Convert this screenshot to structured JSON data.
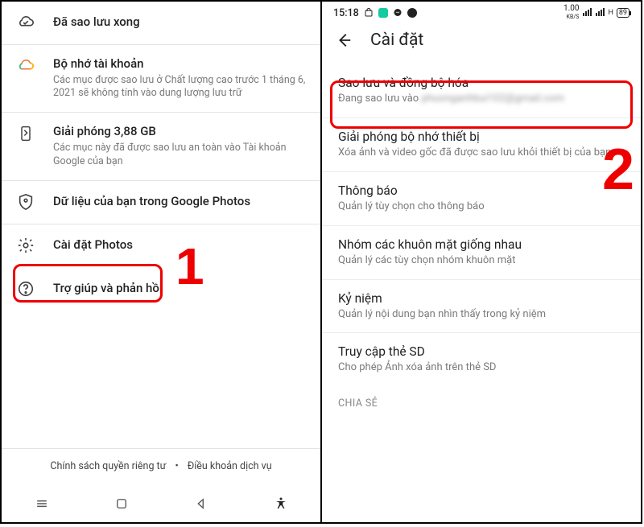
{
  "left": {
    "backup_done": "Đã sao lưu xong",
    "storage": {
      "title": "Bộ nhớ tài khoản",
      "sub": "Các mục được sao lưu ở Chất lượng cao trước 1 tháng 6, 2021 sẽ không tính vào dung lượng lưu trữ"
    },
    "free_up": {
      "title": "Giải phóng 3,88 GB",
      "sub": "Các mục này đã được sao lưu an toàn vào Tài khoản Google của bạn"
    },
    "your_data": "Dữ liệu của bạn trong Google Photos",
    "settings": "Cài đặt Photos",
    "help": "Trợ giúp và phản hồi",
    "privacy": "Chính sách quyền riêng tư",
    "terms": "Điều khoản dịch vụ"
  },
  "right": {
    "status_time": "15:18",
    "status_speed": "1.00",
    "status_speed_unit": "KB/S",
    "status_battery": "89",
    "header": "Cài đặt",
    "backup": {
      "title": "Sao lưu và đồng bộ hóa",
      "sub_prefix": "Đang sao lưu vào ",
      "sub_blur": "phuonganhbui102@gmail.com"
    },
    "free": {
      "title": "Giải phóng bộ nhớ thiết bị",
      "sub": "Xóa ảnh và video gốc đã được sao lưu khỏi thiết bị của bạn"
    },
    "notif": {
      "title": "Thông báo",
      "sub": "Quản lý tùy chọn cho thông báo"
    },
    "faces": {
      "title": "Nhóm các khuôn mặt giống nhau",
      "sub": "Quản lý các tùy chọn nhóm khuôn mặt"
    },
    "memories": {
      "title": "Kỷ niệm",
      "sub": "Quản lý nội dung bạn nhìn thấy trong kỷ niệm"
    },
    "sd": {
      "title": "Truy cập thẻ SD",
      "sub": "Cho phép Ảnh xóa ảnh trên thẻ SD"
    },
    "share_label": "CHIA SẺ"
  },
  "annot": {
    "one": "1",
    "two": "2"
  }
}
